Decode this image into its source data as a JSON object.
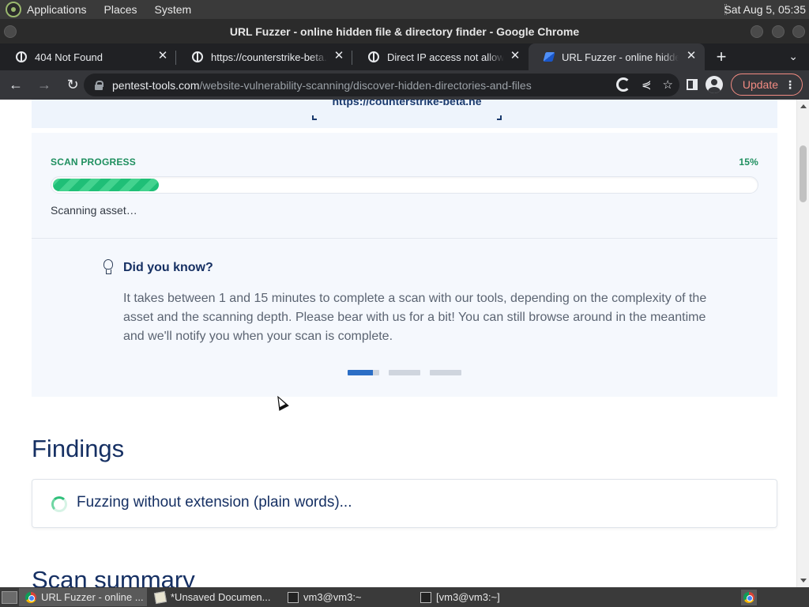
{
  "os_panel": {
    "menus": [
      "Applications",
      "Places",
      "System"
    ],
    "clock": "Sat Aug  5, 05:35"
  },
  "window": {
    "title": "URL Fuzzer - online hidden file & directory finder - Google Chrome"
  },
  "tabs": [
    {
      "title": "404 Not Found",
      "icon": "globe-icon",
      "active": false
    },
    {
      "title": "https://counterstrike-beta.n",
      "icon": "globe-icon",
      "active": false
    },
    {
      "title": "Direct IP access not allowed",
      "icon": "globe-icon",
      "active": false
    },
    {
      "title": "URL Fuzzer - online hidden f",
      "icon": "pentest-tools-icon",
      "active": true
    }
  ],
  "toolbar": {
    "url_host": "pentest-tools.com",
    "url_path": "/website-vulnerability-scanning/discover-hidden-directories-and-files",
    "update_label": "Update"
  },
  "page": {
    "target_url": "https://counterstrike-beta.ne",
    "progress": {
      "label": "SCAN PROGRESS",
      "percent_text": "15%",
      "value": 0.15,
      "status": "Scanning asset…"
    },
    "did_you_know": {
      "title": "Did you know?",
      "text": "It takes between 1 and 15 minutes to complete a scan with our tools, depending on the complexity of the asset and the scanning depth. Please bear with us for a bit! You can still browse around in the meantime and we'll notify you when your scan is complete.",
      "slides": 3,
      "active_slide": 1
    },
    "findings": {
      "title": "Findings",
      "status": "Fuzzing without extension (plain words)..."
    },
    "summary_title": "Scan summary"
  },
  "taskbar": {
    "tasks": [
      {
        "label": "URL Fuzzer - online ...",
        "icon": "chrome-icon",
        "active": true
      },
      {
        "label": "*Unsaved Documen...",
        "icon": "text-editor-icon",
        "active": false
      },
      {
        "label": "vm3@vm3:~",
        "icon": "terminal-icon",
        "active": false
      },
      {
        "label": "[vm3@vm3:~]",
        "icon": "terminal-icon",
        "active": false
      }
    ]
  },
  "colors": {
    "progress_green": "#1fbf77",
    "heading_navy": "#163063",
    "update_red": "#f28b82"
  }
}
